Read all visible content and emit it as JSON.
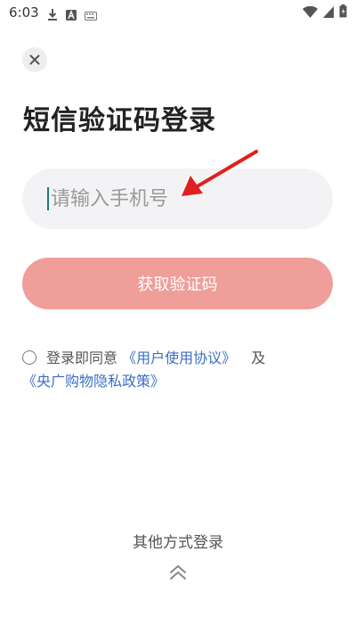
{
  "status_bar": {
    "time": "6:03",
    "icons": [
      "download-icon",
      "a-icon",
      "keyboard-icon",
      "wifi-icon",
      "signal-icon",
      "battery-icon"
    ]
  },
  "header": {
    "close_icon": "close-icon",
    "title": "短信验证码登录"
  },
  "form": {
    "phone_placeholder": "请输入手机号",
    "get_code_label": "获取验证码"
  },
  "agreement": {
    "prefix": "登录即同意",
    "user_agreement": "《用户使用协议》",
    "and": "及",
    "privacy_policy": "《央广购物隐私政策》"
  },
  "bottom": {
    "other_methods": "其他方式登录",
    "expand_icon": "chevron-up-double-icon"
  },
  "colors": {
    "button": "#ef9e9a",
    "link": "#3c6fc4",
    "annotation_arrow": "#e02020"
  }
}
